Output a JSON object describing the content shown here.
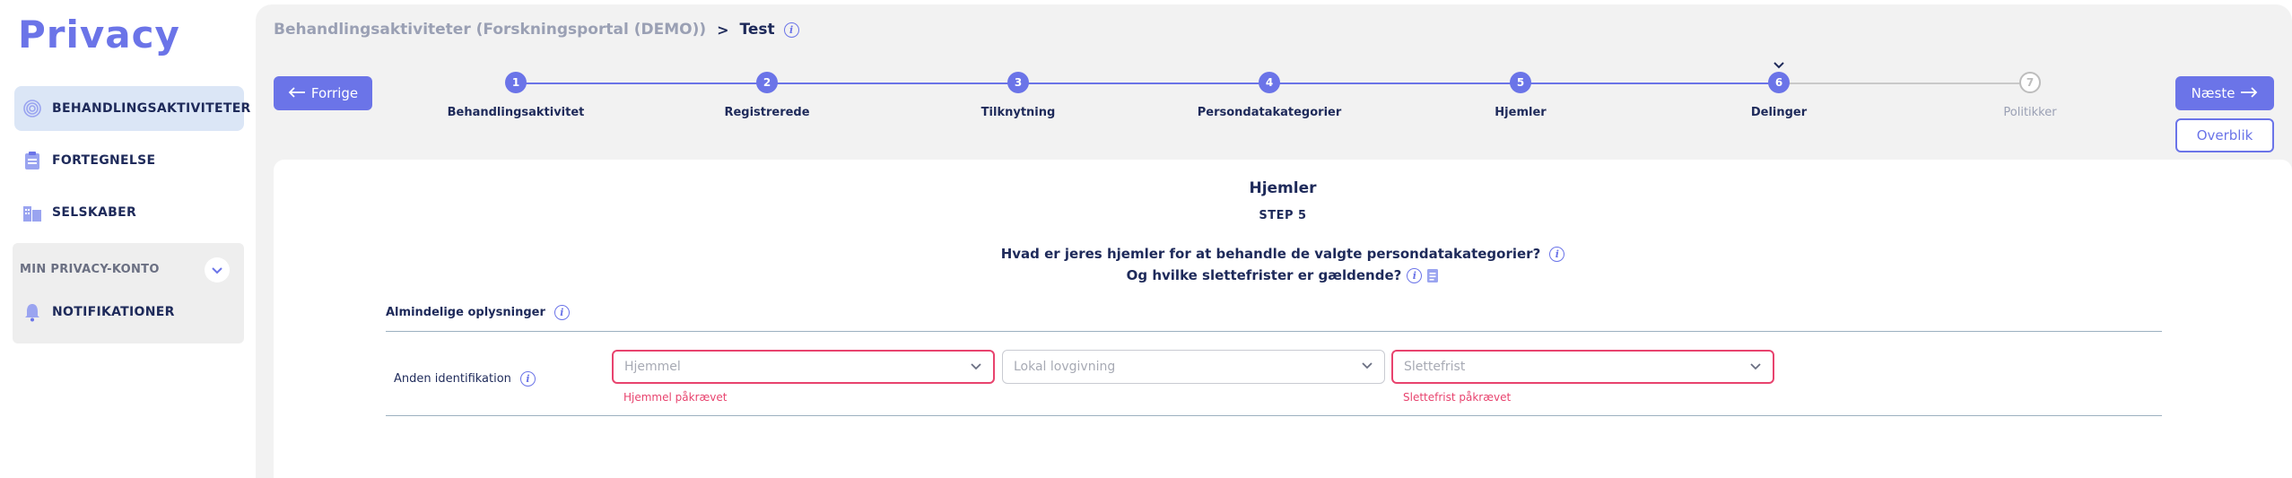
{
  "app": {
    "logo": "Privacy"
  },
  "sidebar": {
    "items": [
      {
        "label": "BEHANDLINGSAKTIVITETER",
        "icon": "fingerprint-icon",
        "active": true
      },
      {
        "label": "FORTEGNELSE",
        "icon": "clipboard-icon",
        "active": false
      },
      {
        "label": "SELSKABER",
        "icon": "buildings-icon",
        "active": false
      }
    ],
    "account": {
      "title": "MIN PRIVACY-KONTO",
      "items": [
        {
          "label": "NOTIFIKATIONER",
          "icon": "bell-icon"
        }
      ]
    }
  },
  "breadcrumb": {
    "parent": "Behandlingsaktiviteter (Forskningsportal (DEMO))",
    "separator": ">",
    "current": "Test"
  },
  "nav": {
    "prev_label": "Forrige",
    "next_label": "Næste",
    "overview_label": "Overblik"
  },
  "stepper": {
    "current": 5,
    "steps": [
      {
        "number": "1",
        "label": "Behandlingsaktivitet",
        "done": true
      },
      {
        "number": "2",
        "label": "Registrerede",
        "done": true
      },
      {
        "number": "3",
        "label": "Tilknytning",
        "done": true
      },
      {
        "number": "4",
        "label": "Persondatakategorier",
        "done": true
      },
      {
        "number": "5",
        "label": "Hjemler",
        "done": true
      },
      {
        "number": "6",
        "label": "Delinger",
        "done": true
      },
      {
        "number": "7",
        "label": "Politikker",
        "done": false
      }
    ]
  },
  "card": {
    "title": "Hjemler",
    "step": "STEP 5",
    "question1": "Hvad er jeres hjemler for at behandle de valgte persondatakategorier?",
    "question2": "Og hvilke slettefrister er gældende?",
    "section": "Almindelige oplysninger",
    "row": {
      "label": "Anden identifikation",
      "hjemmel_placeholder": "Hjemmel",
      "lovgivning_placeholder": "Lokal lovgivning",
      "slettefrist_placeholder": "Slettefrist",
      "hjemmel_error": "Hjemmel påkrævet",
      "slettefrist_error": "Slettefrist påkrævet"
    }
  },
  "colors": {
    "accent": "#6b74e8",
    "error": "#e8436e",
    "text": "#1e2a5a",
    "active_bg": "#dbe6f6"
  }
}
